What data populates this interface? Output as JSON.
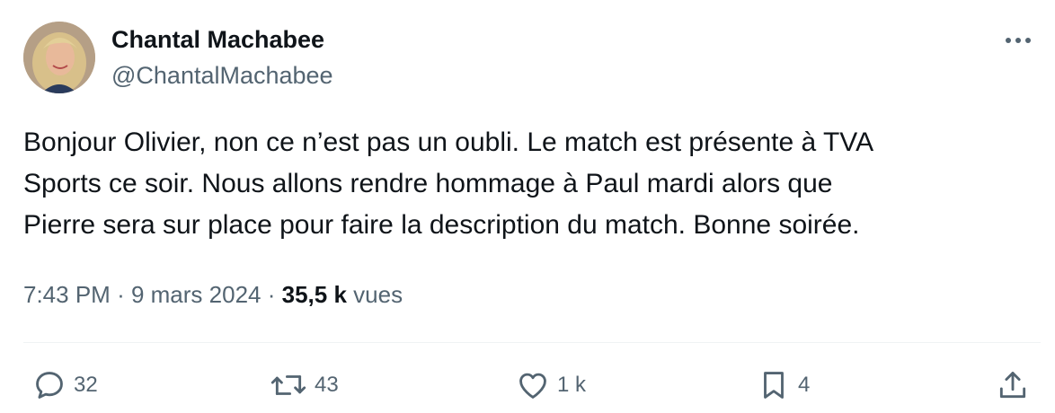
{
  "author": {
    "display_name": "Chantal Machabee",
    "handle": "@ChantalMachabee",
    "avatar_icon": "profile-photo"
  },
  "tweet": {
    "text_lines": [
      "Bonjour Olivier, non ce n’est pas un oubli. Le match est présente à TVA",
      "Sports ce soir. Nous allons rendre hommage à Paul mardi alors que",
      "Pierre sera sur place pour faire la description du match. Bonne soirée."
    ]
  },
  "meta": {
    "time": "7:43 PM",
    "separator": "·",
    "date": "9 mars 2024",
    "views_count": "35,5 k",
    "views_label": "vues"
  },
  "actions": {
    "reply": {
      "icon": "reply-icon",
      "count": "32"
    },
    "retweet": {
      "icon": "retweet-icon",
      "count": "43"
    },
    "like": {
      "icon": "heart-icon",
      "count": "1 k"
    },
    "bookmark": {
      "icon": "bookmark-icon",
      "count": "4"
    },
    "share": {
      "icon": "share-icon"
    }
  },
  "colors": {
    "text_primary": "#0f1419",
    "text_secondary": "#536471",
    "divider": "#eff3f4"
  }
}
